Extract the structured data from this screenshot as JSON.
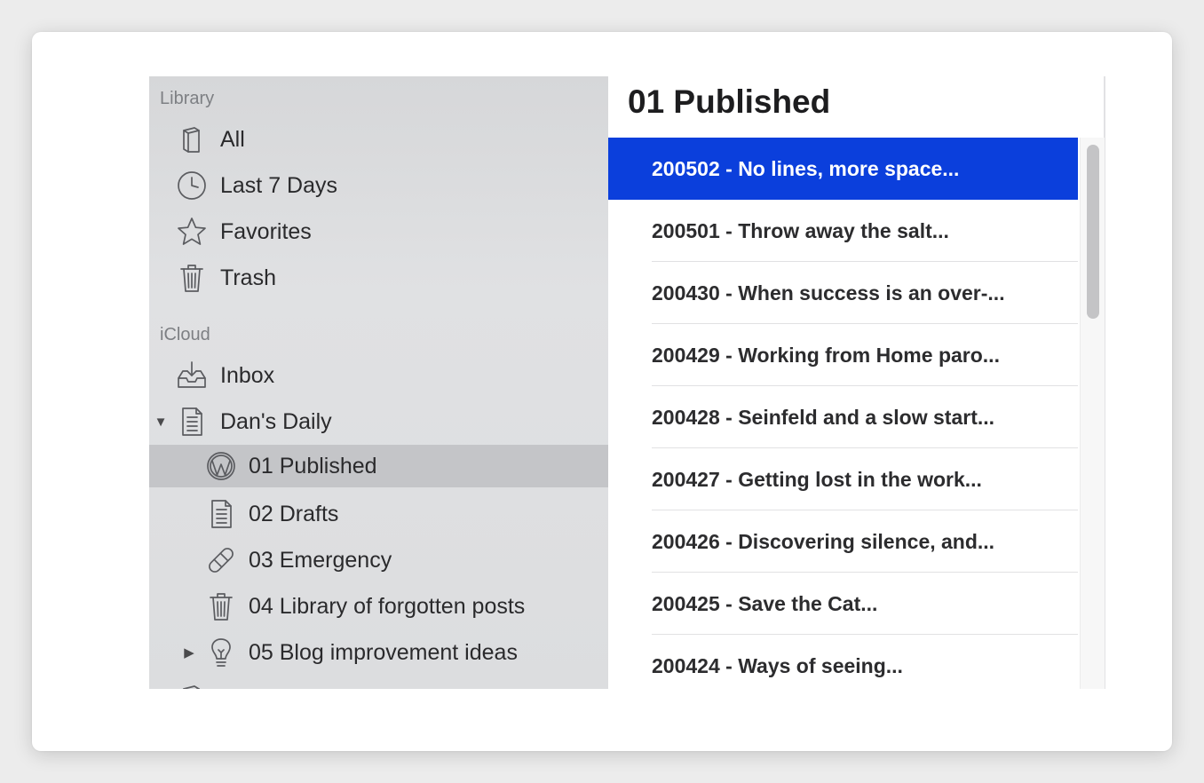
{
  "sidebar": {
    "library_label": "Library",
    "icloud_label": "iCloud",
    "items": [
      {
        "label": "All"
      },
      {
        "label": "Last 7 Days"
      },
      {
        "label": "Favorites"
      },
      {
        "label": "Trash"
      },
      {
        "label": "Inbox"
      },
      {
        "label": "Dan's Daily"
      },
      {
        "label": "01 Published"
      },
      {
        "label": "02 Drafts"
      },
      {
        "label": "03 Emergency"
      },
      {
        "label": "04 Library of forgotten posts"
      },
      {
        "label": "05 Blog improvement ideas"
      }
    ]
  },
  "main": {
    "title": "01 Published",
    "rows": [
      {
        "label": "200502 - No lines, more space..."
      },
      {
        "label": "200501 - Throw away the salt..."
      },
      {
        "label": "200430 - When success is an over-..."
      },
      {
        "label": "200429 - Working from Home paro..."
      },
      {
        "label": "200428 - Seinfeld and a slow start..."
      },
      {
        "label": "200427 - Getting lost in the work..."
      },
      {
        "label": "200426 - Discovering silence, and..."
      },
      {
        "label": "200425 - Save the Cat..."
      },
      {
        "label": "200424 - Ways of seeing..."
      }
    ]
  },
  "colors": {
    "selection": "#0b3fdc",
    "sidebar_selection": "#c4c5c8"
  }
}
